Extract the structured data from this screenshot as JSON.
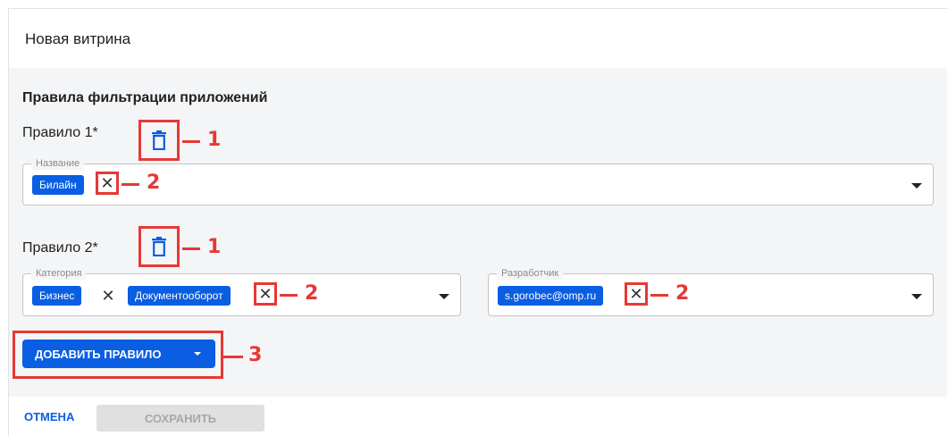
{
  "dialog": {
    "title": "Новая витрина",
    "section_title": "Правила фильтрации приложений",
    "add_rule_label": "ДОБАВИТЬ ПРАВИЛО",
    "cancel_label": "ОТМЕНА",
    "save_label": "СОХРАНИТЬ"
  },
  "rules": [
    {
      "label": "Правило 1*",
      "fields": [
        {
          "legend": "Название",
          "chips": [
            "Билайн"
          ]
        }
      ]
    },
    {
      "label": "Правило 2*",
      "fields": [
        {
          "legend": "Категория",
          "chips": [
            "Бизнес",
            "Документооборот"
          ]
        },
        {
          "legend": "Разработчик",
          "chips": [
            "s.gorobec@omp.ru"
          ]
        }
      ]
    }
  ],
  "callouts": {
    "delete_rule": "1",
    "remove_value": "2",
    "add_rule": "3"
  },
  "icons": {
    "delete": "trash-icon",
    "remove_chip": "close-icon",
    "dropdown": "caret-down-icon"
  },
  "colors": {
    "accent": "#0a5ee1",
    "highlight": "#e53935",
    "content_bg": "#f4f5f7",
    "disabled_bg": "#e0e0e0"
  },
  "glyphs": {
    "close": "✕"
  }
}
